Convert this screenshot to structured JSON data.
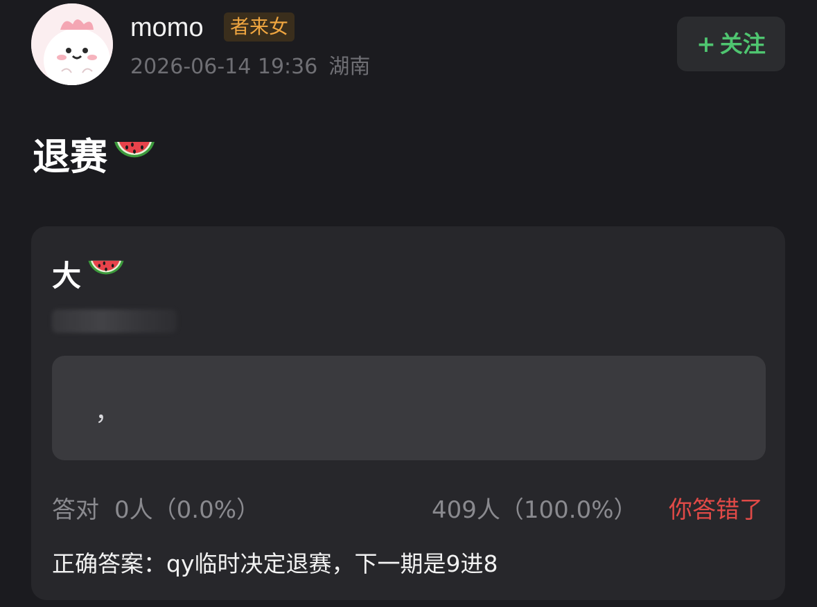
{
  "author": {
    "username": "momo",
    "tag": "者来女",
    "date": "2026-06-14 19:36",
    "location": "湖南"
  },
  "follow_button": {
    "plus": "+",
    "label": "关注"
  },
  "post": {
    "title": "退赛",
    "title_emoji": "watermelon-emoji"
  },
  "quiz": {
    "question": "大",
    "question_emoji": "watermelon-emoji",
    "option_text": "，",
    "correct_label": "答对",
    "correct_stat": "0人（0.0%）",
    "wrong_stat": "409人（100.0%）",
    "result_text": "你答错了",
    "answer_text": "正确答案：qy临时决定退赛，下一期是9进8"
  },
  "colors": {
    "background": "#1b1b1f",
    "card": "#27272b",
    "option": "#3a3a3e",
    "follow_green": "#4fc570",
    "tag_orange": "#f0a640",
    "wrong_red": "#e14a47"
  }
}
